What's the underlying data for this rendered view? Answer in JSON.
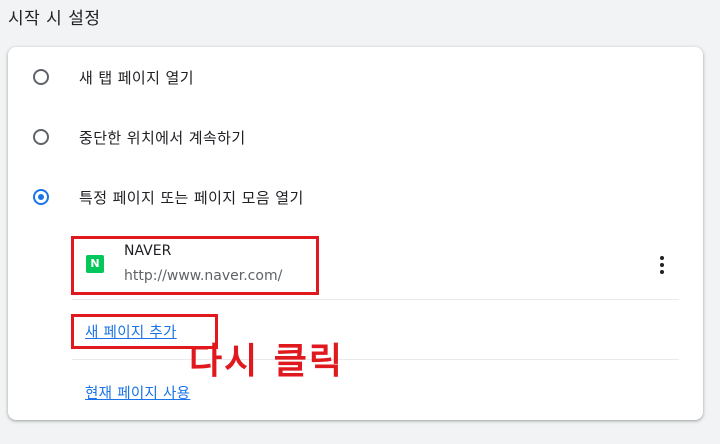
{
  "section": {
    "title": "시작 시 설정"
  },
  "options": [
    {
      "label": "새 탭 페이지 열기",
      "checked": false
    },
    {
      "label": "중단한 위치에서 계속하기",
      "checked": false
    },
    {
      "label": "특정 페이지 또는 페이지 모음 열기",
      "checked": true
    }
  ],
  "site": {
    "favicon_letter": "N",
    "name": "NAVER",
    "url": "http://www.naver.com/",
    "favicon_color": "#03c75a",
    "menu_icon": "more-vert-icon"
  },
  "links": {
    "add_page": "새 페이지 추가",
    "use_current": "현재 페이지 사용"
  },
  "annotation": {
    "text": "다시 클릭",
    "color": "#e0191f"
  },
  "colors": {
    "accent": "#1a73e8",
    "highlight": "#e0191f"
  }
}
